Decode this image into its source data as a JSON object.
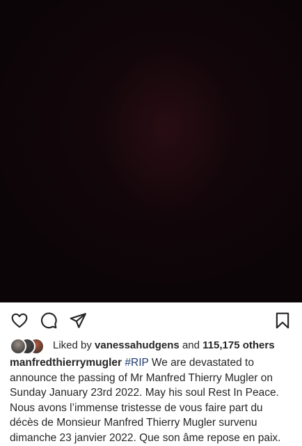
{
  "post": {
    "image_alt": "",
    "background_color": "#0c0508"
  },
  "actions": {
    "like_icon": "heart-outline-icon",
    "comment_icon": "comment-bubble-icon",
    "share_icon": "paper-plane-icon",
    "save_icon": "bookmark-outline-icon"
  },
  "likes": {
    "prefix": "Liked by",
    "liker": "vanessahudgens",
    "connector": "and",
    "count_text": "115,175 others",
    "avatar_colors": [
      "#9a8f86",
      "#4a4a4a",
      "#b0583e"
    ]
  },
  "caption": {
    "username": "manfredthierrymugler",
    "hashtag": "#RIP",
    "text": "We are devastated to announce the passing of Mr Manfred Thierry Mugler on Sunday January 23rd 2022. May his soul Rest In Peace. Nous avons l’immense tristesse de vous faire part du décès de Monsieur Manfred Thierry Mugler survenu dimanche 23 janvier 2022. Que son âme repose en paix."
  }
}
